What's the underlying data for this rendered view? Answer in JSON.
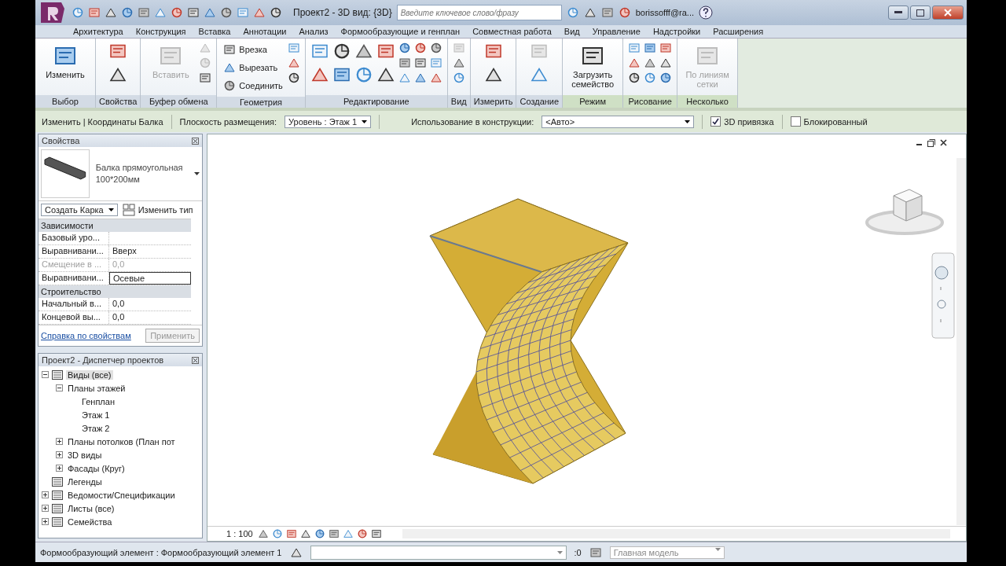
{
  "title_bar": {
    "title": "Проект2 - 3D вид: {3D}",
    "search_placeholder": "Введите ключевое слово/фразу",
    "user": "borissofff@ra..."
  },
  "ribbon_tabs": [
    "Архитектура",
    "Конструкция",
    "Вставка",
    "Аннотации",
    "Анализ",
    "Формообразующие и генплан",
    "Совместная работа",
    "Вид",
    "Управление",
    "Надстройки",
    "Расширения"
  ],
  "ribbon_panels": [
    {
      "label": "Выбор",
      "context": false,
      "tools": [
        {
          "kind": "large",
          "label": "Изменить",
          "disabled": false
        }
      ]
    },
    {
      "label": "Свойства",
      "context": false,
      "tools": [
        {
          "kind": "medium",
          "disabled": false
        },
        {
          "kind": "medium",
          "disabled": false
        }
      ]
    },
    {
      "label": "Буфер обмена",
      "context": false,
      "tools": [
        {
          "kind": "large",
          "label": "Вставить",
          "disabled": true
        },
        {
          "kind": "small",
          "disabled": true
        },
        {
          "kind": "small",
          "disabled": true
        },
        {
          "kind": "small",
          "disabled": false
        }
      ]
    },
    {
      "label": "Геометрия",
      "context": false,
      "tools": [
        {
          "kind": "small",
          "label": "Врезка",
          "disabled": false
        },
        {
          "kind": "small",
          "label": "Вырезать",
          "disabled": false
        },
        {
          "kind": "small",
          "label": "Соединить",
          "disabled": false
        },
        {
          "kind": "small",
          "disabled": false
        },
        {
          "kind": "small",
          "disabled": false
        },
        {
          "kind": "small",
          "disabled": false
        }
      ]
    },
    {
      "label": "Редактирование",
      "context": false,
      "tools": [
        {
          "kind": "medium",
          "disabled": false
        },
        {
          "kind": "medium",
          "disabled": false
        },
        {
          "kind": "medium",
          "disabled": false
        },
        {
          "kind": "medium",
          "disabled": false
        },
        {
          "kind": "medium",
          "disabled": false
        },
        {
          "kind": "medium",
          "disabled": false
        },
        {
          "kind": "medium",
          "disabled": false
        },
        {
          "kind": "medium",
          "disabled": false
        },
        {
          "kind": "small",
          "disabled": false
        },
        {
          "kind": "small",
          "disabled": false
        },
        {
          "kind": "small",
          "disabled": false
        },
        {
          "kind": "small",
          "disabled": false
        },
        {
          "kind": "small",
          "disabled": false
        },
        {
          "kind": "small",
          "disabled": false
        },
        {
          "kind": "small",
          "disabled": false
        },
        {
          "kind": "small",
          "disabled": false
        },
        {
          "kind": "small",
          "disabled": false
        }
      ]
    },
    {
      "label": "Вид",
      "context": false,
      "tools": [
        {
          "kind": "small",
          "disabled": true
        },
        {
          "kind": "small",
          "disabled": false
        },
        {
          "kind": "small",
          "disabled": false
        }
      ]
    },
    {
      "label": "Измерить",
      "context": false,
      "tools": [
        {
          "kind": "medium",
          "disabled": false
        },
        {
          "kind": "medium",
          "disabled": false
        }
      ]
    },
    {
      "label": "Создание",
      "context": false,
      "tools": [
        {
          "kind": "medium",
          "disabled": true
        },
        {
          "kind": "medium",
          "disabled": false
        }
      ]
    },
    {
      "label": "Режим",
      "context": true,
      "tools": [
        {
          "kind": "large",
          "label": "Загрузить семейство",
          "disabled": false
        }
      ]
    },
    {
      "label": "Рисование",
      "context": true,
      "tools": [
        {
          "kind": "small",
          "disabled": false
        },
        {
          "kind": "small",
          "disabled": false
        },
        {
          "kind": "small",
          "disabled": false
        },
        {
          "kind": "small",
          "disabled": false
        },
        {
          "kind": "small",
          "disabled": false
        },
        {
          "kind": "small",
          "disabled": false
        },
        {
          "kind": "small",
          "disabled": false
        },
        {
          "kind": "small",
          "disabled": false
        },
        {
          "kind": "small",
          "disabled": false
        }
      ]
    },
    {
      "label": "Несколько",
      "context": true,
      "tools": [
        {
          "kind": "large",
          "label": "По линиям сетки",
          "disabled": true
        }
      ]
    }
  ],
  "options_bar": {
    "context": "Изменить | Координаты Балка",
    "placement_label": "Плоскость размещения:",
    "placement_value": "Уровень : Этаж 1",
    "usage_label": "Использование в конструкции:",
    "usage_value": "<Авто>",
    "checkboxes": [
      {
        "label": "3D привязка",
        "checked": true
      },
      {
        "label": "Блокированный",
        "checked": false
      }
    ]
  },
  "properties": {
    "title": "Свойства",
    "type_name": "Балка прямоугольная 100*200мм",
    "filter": "Создать Карка",
    "edit_type": "Изменить тип",
    "groups": [
      {
        "label": "Зависимости",
        "rows": [
          {
            "name": "Базовый уро...",
            "disabled": false
          },
          {
            "name": "Выравнивани...",
            "value": "Вверх",
            "disabled": false
          },
          {
            "name": "Смещение в ...",
            "value": "0,0",
            "disabled": true
          },
          {
            "name": "Выравнивани...",
            "value": "Осевые",
            "disabled": false,
            "editing": true
          }
        ]
      },
      {
        "label": "Строительство",
        "rows": [
          {
            "name": "Начальный в...",
            "value": "0,0",
            "disabled": false
          },
          {
            "name": "Концевой вы...",
            "value": "0,0",
            "disabled": false
          }
        ]
      }
    ],
    "help_link": "Справка по свойствам",
    "apply": "Применить"
  },
  "project_browser": {
    "title": "Проект2 - Диспетчер проектов",
    "tree": [
      {
        "label": "Виды (все)",
        "expanded": true,
        "selected": true,
        "children": [
          {
            "label": "Планы этажей",
            "expanded": true,
            "selected": false,
            "children": [
              {
                "label": "Генплан",
                "selected": false
              },
              {
                "label": "Этаж 1",
                "selected": false
              },
              {
                "label": "Этаж 2",
                "selected": false
              }
            ]
          },
          {
            "label": "Планы потолков (План пот",
            "expanded": false,
            "selected": false
          },
          {
            "label": "3D виды",
            "expanded": false,
            "selected": false
          },
          {
            "label": "Фасады (Круг)",
            "expanded": false,
            "selected": false
          }
        ]
      },
      {
        "label": "Легенды",
        "selected": false
      },
      {
        "label": "Ведомости/Спецификации",
        "expanded": false,
        "selected": false
      },
      {
        "label": "Листы (все)",
        "expanded": false,
        "selected": false
      },
      {
        "label": "Семейства",
        "expanded": false,
        "selected": false
      }
    ]
  },
  "view": {
    "scale": "1 : 100"
  },
  "status_bar": {
    "text": "Формообразующий элемент : Формообразующий элемент 1",
    "count": ":0",
    "model": "Главная модель"
  }
}
